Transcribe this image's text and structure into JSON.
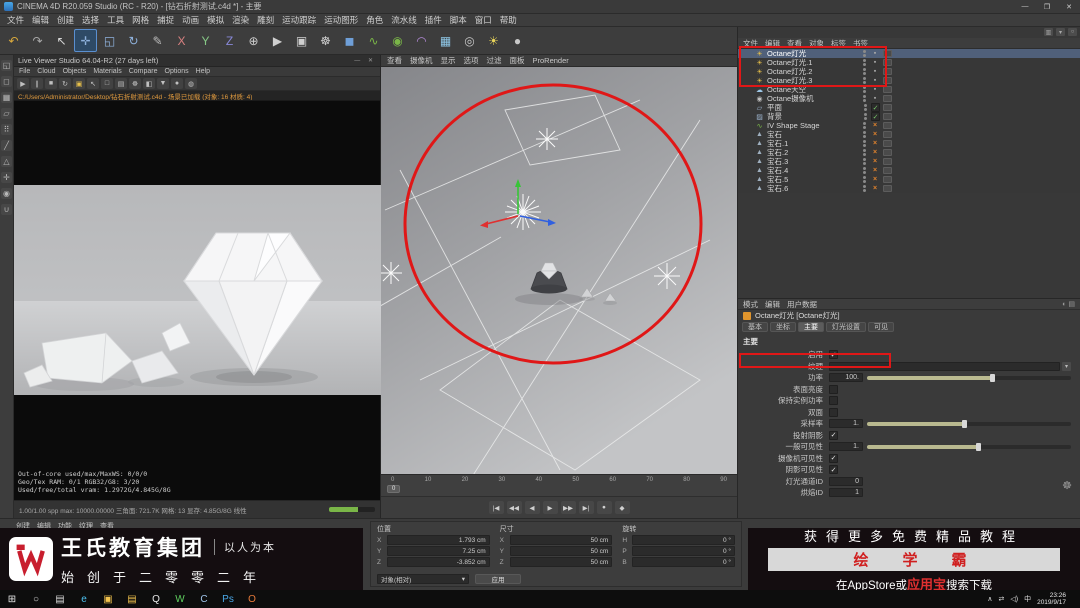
{
  "titlebar": {
    "title": "CINEMA 4D R20.059 Studio (RC - R20) - [钻石折射测试.c4d *] - 主要",
    "minimize": "—",
    "maximize": "❐",
    "close": "✕"
  },
  "menubar": {
    "items": [
      "文件",
      "编辑",
      "创建",
      "选择",
      "工具",
      "网格",
      "捕捉",
      "动画",
      "模拟",
      "渲染",
      "雕刻",
      "运动跟踪",
      "运动图形",
      "角色",
      "流水线",
      "插件",
      "脚本",
      "窗口",
      "帮助"
    ]
  },
  "toolbar": {
    "icons": [
      {
        "name": "undo",
        "glyph": "↶",
        "color": "#d9a93c"
      },
      {
        "name": "redo",
        "glyph": "↷",
        "color": "#a8a8a8"
      },
      {
        "name": "live-selection",
        "glyph": "↖",
        "color": "#d8d8d8"
      },
      {
        "name": "move",
        "glyph": "✛",
        "color": "#8fb2dd",
        "active": true
      },
      {
        "name": "scale",
        "glyph": "◱",
        "color": "#8fb2dd"
      },
      {
        "name": "rotate",
        "glyph": "↻",
        "color": "#8fb2dd"
      },
      {
        "name": "last-tool",
        "glyph": "✎",
        "color": "#bbbbbb"
      },
      {
        "name": "lock-x",
        "glyph": "X",
        "color": "#d88080"
      },
      {
        "name": "lock-y",
        "glyph": "Y",
        "color": "#86c886"
      },
      {
        "name": "lock-z",
        "glyph": "Z",
        "color": "#8888d8"
      },
      {
        "name": "coord-system",
        "glyph": "⊕",
        "color": "#cccccc"
      },
      {
        "name": "render-view",
        "glyph": "▶",
        "color": "#cfcfcf"
      },
      {
        "name": "render-picture-viewer",
        "glyph": "▣",
        "color": "#cfcfcf"
      },
      {
        "name": "render-settings",
        "glyph": "☸",
        "color": "#cfcfcf"
      },
      {
        "name": "add-primitive",
        "glyph": "◼",
        "color": "#6f9fd8"
      },
      {
        "name": "add-spline",
        "glyph": "∿",
        "color": "#7ab648"
      },
      {
        "name": "add-generator",
        "glyph": "◉",
        "color": "#7ab648"
      },
      {
        "name": "add-deformer",
        "glyph": "◠",
        "color": "#b48ad8"
      },
      {
        "name": "add-environment",
        "glyph": "▦",
        "color": "#8fc8e8"
      },
      {
        "name": "add-camera",
        "glyph": "◎",
        "color": "#c8c8c8"
      },
      {
        "name": "add-light",
        "glyph": "☀",
        "color": "#e8d45a"
      },
      {
        "name": "add-material",
        "glyph": "●",
        "color": "#c8c8c8"
      }
    ]
  },
  "left_rail": {
    "icons": [
      {
        "name": "make-editable",
        "glyph": "◱"
      },
      {
        "name": "model-mode",
        "glyph": "◻"
      },
      {
        "name": "texture-mode",
        "glyph": "▦"
      },
      {
        "name": "workplane-mode",
        "glyph": "▱"
      },
      {
        "name": "points-mode",
        "glyph": "⠿"
      },
      {
        "name": "edges-mode",
        "glyph": "╱"
      },
      {
        "name": "polygons-mode",
        "glyph": "△"
      },
      {
        "name": "enable-axis",
        "glyph": "✛"
      },
      {
        "name": "viewport-solo",
        "glyph": "◉"
      },
      {
        "name": "enable-snap",
        "glyph": "∪"
      }
    ]
  },
  "live_viewer": {
    "title": "Live Viewer Studio 64.04-R2 (27 days left)",
    "window_buttons": "— ✕",
    "menu": [
      "File",
      "Cloud",
      "Objects",
      "Materials",
      "Compare",
      "Options",
      "Help"
    ],
    "info": "C:/Users/Administrator/Desktop/钻石折射测试.c4d - 场景已加载 (对象: 16  材质: 4)",
    "tools": [
      {
        "name": "play",
        "glyph": "▶"
      },
      {
        "name": "pause",
        "glyph": "∥"
      },
      {
        "name": "stop",
        "glyph": "■"
      },
      {
        "name": "restart-render",
        "glyph": "↻"
      },
      {
        "name": "lock-resolution",
        "glyph": "▣",
        "color": "#e8c04a"
      },
      {
        "name": "pick-focus",
        "glyph": "↖"
      },
      {
        "name": "region-render",
        "glyph": "□"
      },
      {
        "name": "film-settings",
        "glyph": "▤"
      },
      {
        "name": "kernel-settings",
        "glyph": "☸"
      },
      {
        "name": "compare-ab",
        "glyph": "◧"
      },
      {
        "name": "save-image",
        "glyph": "▼"
      },
      {
        "name": "clay-mode",
        "glyph": "●"
      },
      {
        "name": "info-channels",
        "glyph": "◍"
      }
    ],
    "stats": [
      "Out-of-core used/max/MaxWS: 0/0/0",
      "Geo/Tex RAM: 0/1   RGB32/G8: 3/20",
      "Used/free/total vram: 1.2972G/4.845G/8G"
    ],
    "footer": "1.00/1.00 spp  max: 10000.00000  三角面: 721.7K  网格: 13  显存: 4.85G/8G  线性",
    "progress": 62
  },
  "viewport": {
    "menu": [
      "查看",
      "摄像机",
      "显示",
      "选项",
      "过滤",
      "面板",
      "ProRender"
    ],
    "timeline_ticks": [
      "0",
      "10",
      "20",
      "30",
      "40",
      "50",
      "60",
      "70",
      "80",
      "90"
    ],
    "current_frame": "0",
    "transport": [
      "|◀",
      "◀◀",
      "◀",
      "▶",
      "▶▶",
      "▶|",
      "●",
      "◆"
    ]
  },
  "object_manager": {
    "menu": [
      "文件",
      "编辑",
      "查看",
      "对象",
      "标签",
      "书签"
    ],
    "items": [
      {
        "label": "Octane灯光",
        "icon": "light",
        "cls": "sel",
        "tag": "sq"
      },
      {
        "label": "Octane灯光.1",
        "icon": "light",
        "tag": "sq"
      },
      {
        "label": "Octane灯光.2",
        "icon": "light",
        "tag": "sq"
      },
      {
        "label": "Octane灯光.3",
        "icon": "light",
        "tag": "sq"
      },
      {
        "label": "Octane天空",
        "icon": "sky",
        "tag": "sq"
      },
      {
        "label": "Octane摄像机",
        "icon": "camera",
        "tag": "sq"
      },
      {
        "label": "平面",
        "icon": "plane",
        "tag": "chk"
      },
      {
        "label": "背景",
        "icon": "bg",
        "tag": "chk"
      },
      {
        "label": "IV Shape Stage",
        "icon": "spline",
        "tag": "x"
      },
      {
        "label": "宝石",
        "icon": "cone",
        "tag": "x"
      },
      {
        "label": "宝石.1",
        "icon": "cone",
        "tag": "x"
      },
      {
        "label": "宝石.2",
        "icon": "cone",
        "tag": "x"
      },
      {
        "label": "宝石.3",
        "icon": "cone",
        "tag": "x"
      },
      {
        "label": "宝石.4",
        "icon": "cone",
        "tag": "x"
      },
      {
        "label": "宝石.5",
        "icon": "cone",
        "tag": "x"
      },
      {
        "label": "宝石.6",
        "icon": "cone",
        "tag": "x"
      }
    ]
  },
  "attributes": {
    "menu": [
      "模式",
      "编辑",
      "用户数据"
    ],
    "corner": "◐ ▤",
    "object_label": "Octane灯光 [Octane灯光]",
    "tabs": [
      {
        "label": "基本"
      },
      {
        "label": "坐标"
      },
      {
        "label": "主要",
        "on": true
      },
      {
        "label": "灯光设置"
      },
      {
        "label": "可见"
      }
    ],
    "section": "主要",
    "rows": [
      {
        "label": "启用",
        "type": "check",
        "checked": true
      },
      {
        "label": "纹理",
        "type": "field",
        "value": ""
      },
      {
        "label": "功率",
        "type": "slider",
        "value": "100.",
        "fill": 62
      },
      {
        "label": "表面亮度",
        "type": "check",
        "checked": false
      },
      {
        "label": "保持实例功率",
        "type": "check",
        "checked": false
      },
      {
        "label": "双面",
        "type": "check",
        "checked": false
      },
      {
        "label": "采样率",
        "type": "slider",
        "value": "1.",
        "fill": 48
      },
      {
        "label": "投射阴影",
        "type": "check",
        "checked": true
      },
      {
        "label": "一般可见性",
        "type": "slider",
        "value": "1.",
        "fill": 55
      },
      {
        "label": "摄像机可见性",
        "type": "check",
        "checked": true
      },
      {
        "label": "阴影可见性",
        "type": "check",
        "checked": true
      },
      {
        "label": "灯光通道ID",
        "type": "number",
        "value": "0"
      },
      {
        "label": "烘焙ID",
        "type": "number",
        "value": "1"
      }
    ]
  },
  "materials_menu": [
    "创建",
    "编辑",
    "功能",
    "纹理",
    "查看"
  ],
  "coords": {
    "groups": [
      {
        "title": "位置",
        "fields": [
          {
            "k": "X",
            "v": "1.793 cm"
          },
          {
            "k": "Y",
            "v": "7.25 cm"
          },
          {
            "k": "Z",
            "v": "-3.852 cm"
          }
        ]
      },
      {
        "title": "尺寸",
        "fields": [
          {
            "k": "X",
            "v": "50 cm"
          },
          {
            "k": "Y",
            "v": "50 cm"
          },
          {
            "k": "Z",
            "v": "50 cm"
          }
        ]
      },
      {
        "title": "旋转",
        "fields": [
          {
            "k": "H",
            "v": "0 °"
          },
          {
            "k": "P",
            "v": "0 °"
          },
          {
            "k": "B",
            "v": "0 °"
          }
        ]
      }
    ],
    "system": "对象(相对)",
    "apply": "应用"
  },
  "banner": {
    "left": {
      "logo": "W",
      "brand": "王氏教育集团",
      "slogan": "以人为本",
      "line2": "始创于二零零二年"
    },
    "right": {
      "line1": "获得更多免费精品教程",
      "highlight": "绘学霸",
      "line3_pre": "在AppStore或",
      "line3_red": "应用宝",
      "line3_post": "搜索下载"
    }
  },
  "taskbar": {
    "icons": [
      {
        "name": "start",
        "glyph": "⊞",
        "color": "#e8e8e8"
      },
      {
        "name": "search",
        "glyph": "○",
        "color": "#d8d8d8"
      },
      {
        "name": "task-view",
        "glyph": "▤",
        "color": "#d8d8d8"
      },
      {
        "name": "edge",
        "glyph": "e",
        "color": "#4ec2f0"
      },
      {
        "name": "explorer",
        "glyph": "▣",
        "color": "#f2c34e"
      },
      {
        "name": "folder",
        "glyph": "▤",
        "color": "#f2c34e"
      },
      {
        "name": "qq",
        "glyph": "Q",
        "color": "#e8e8e8"
      },
      {
        "name": "wechat",
        "glyph": "W",
        "color": "#5fd05f"
      },
      {
        "name": "c4d",
        "glyph": "C",
        "color": "#9fc3e8"
      },
      {
        "name": "photoshop",
        "glyph": "Ps",
        "color": "#4aa8e8"
      },
      {
        "name": "octane",
        "glyph": "O",
        "color": "#e87a3a"
      }
    ],
    "tray": {
      "chevron": "∧",
      "net": "⇄",
      "vol": "◁)",
      "ime": "中",
      "time": "23:26",
      "date": "2019/9/17"
    }
  },
  "colors": {
    "accent_red": "#e01717"
  }
}
